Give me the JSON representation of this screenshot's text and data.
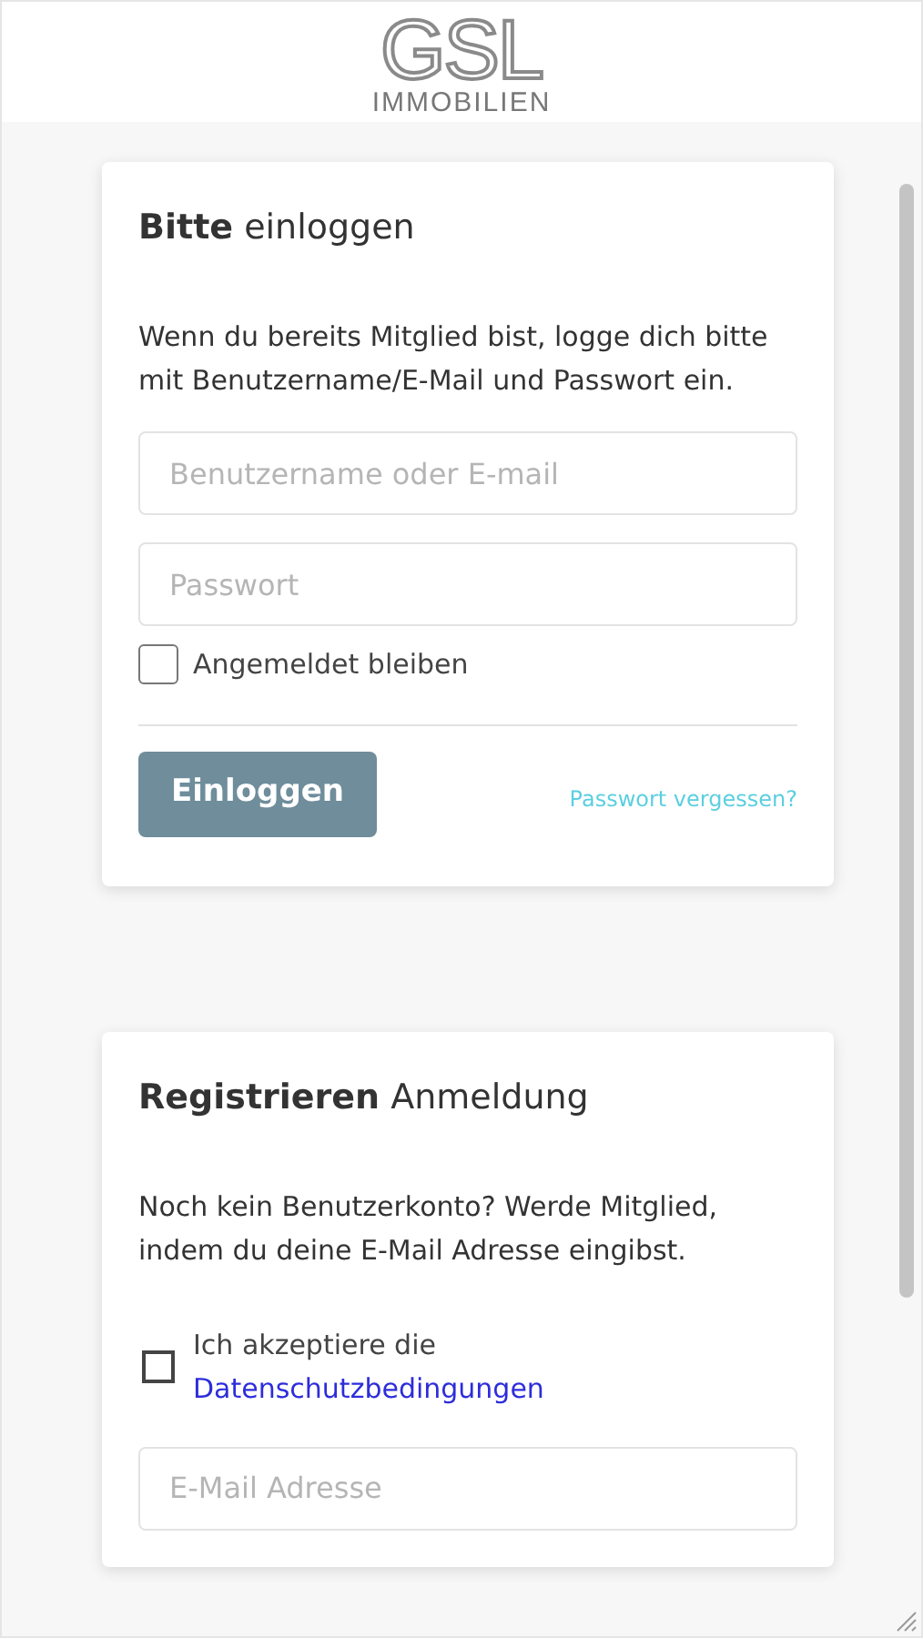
{
  "logo": {
    "name": "GSL",
    "subtitle": "IMMOBILIEN"
  },
  "login": {
    "title": "**Bitte** einloggen",
    "text": "Wenn du bereits Mitglied bist, logge dich bitte mit Benutzername/E-Mail und Passwort ein.",
    "username": {
      "placeholder": "Benutzername oder E-mail"
    },
    "password": {
      "placeholder": "Passwort"
    },
    "remember": {
      "label": "Angemeldet bleiben",
      "checked": false
    },
    "button": "Einloggen",
    "forgot_link": "Passwort vergessen?"
  },
  "register": {
    "title": "**Registrieren** Anmeldung",
    "text": "Noch kein Benutzerkonto? Werde Mitglied, indem du deine E-Mail Adresse eingibst.",
    "consent": {
      "label": "Ich akzeptiere die",
      "link": "Datenschutzbedingungen",
      "checked": false
    },
    "email": {
      "placeholder": "E-Mail Adresse"
    }
  }
}
